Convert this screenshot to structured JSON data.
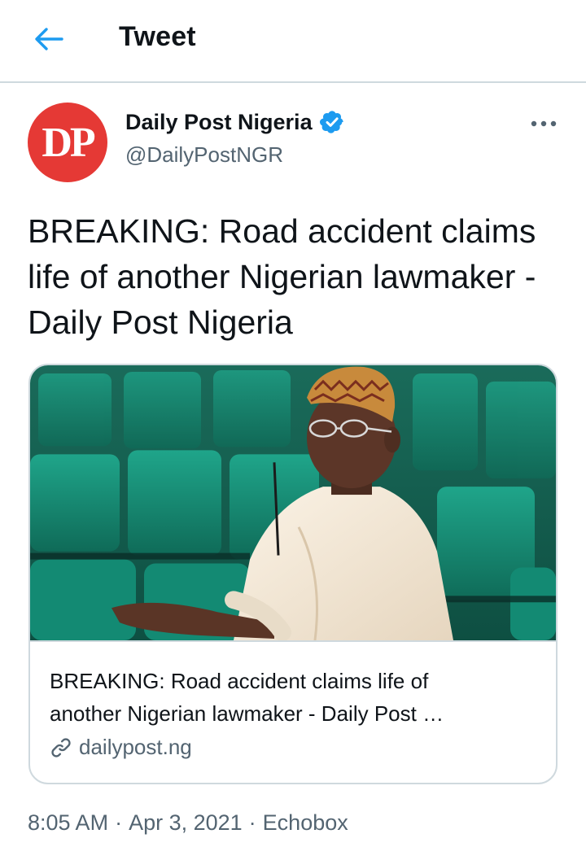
{
  "header": {
    "title": "Tweet"
  },
  "author": {
    "avatar_text": "DP",
    "name": "Daily Post Nigeria",
    "handle": "@DailyPostNGR",
    "verified": true
  },
  "tweet": {
    "text": "BREAKING: Road accident claims life of another Nigerian lawmaker - Daily Post Nigeria"
  },
  "card": {
    "title_line1": "BREAKING: Road accident claims life of",
    "title_line2": "another Nigerian lawmaker - Daily Post …",
    "domain": "dailypost.ng"
  },
  "meta": {
    "time": "8:05 AM",
    "separator1": "·",
    "date": "Apr 3, 2021",
    "separator2": "·",
    "source": "Echobox"
  },
  "colors": {
    "accent": "#1d9bf0",
    "avatar_bg": "#e53935",
    "secondary_text": "#536471",
    "border": "#cfd9de"
  }
}
